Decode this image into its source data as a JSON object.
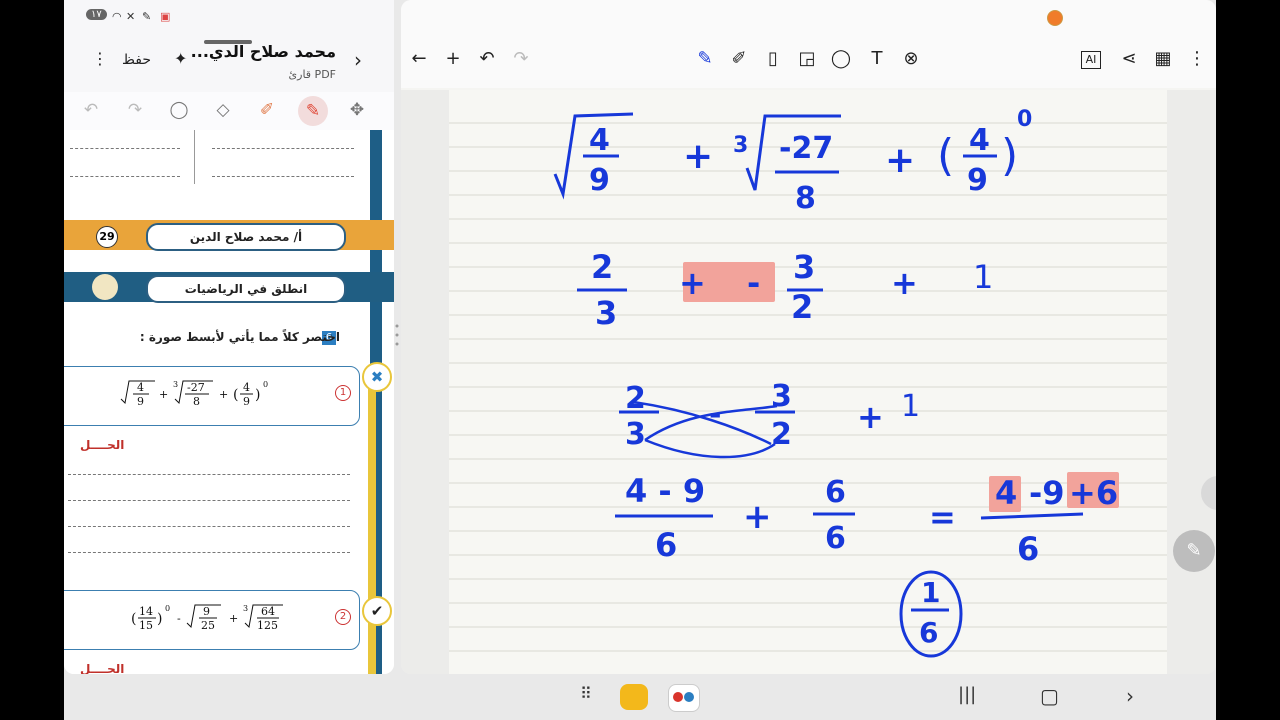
{
  "status_bar": {
    "badge": "۱۷",
    "icons": [
      "alarm-icon",
      "wifi-icon",
      "mute-icon",
      "pen-icon",
      "cast-icon"
    ]
  },
  "pdf_header": {
    "title": "محمد صلاح الدي...",
    "subtitle": "قارئ PDF",
    "save_label": "حفظ"
  },
  "pdf_tools": [
    "undo-icon",
    "redo-icon",
    "lasso-icon",
    "eraser-icon",
    "highlighter-icon",
    "pen-icon",
    "move-icon"
  ],
  "worksheet": {
    "page_number": "29",
    "author_label": "أ/ محمد صلاح الدين",
    "section_label": "انطلق في الرياضيات",
    "question_number": "6",
    "question_heading": "اختصر كلاً مما يأتي لأبسط صورة :",
    "item1_index": "1",
    "item2_index": "2",
    "solution_label": "الحــــل"
  },
  "math_item1": {
    "sqrt_num": "4",
    "sqrt_den": "9",
    "cbrt_index": "3",
    "cbrt_num": "-27",
    "cbrt_den": "8",
    "pow_num": "4",
    "pow_den": "9",
    "pow_exp": "0"
  },
  "math_item2": {
    "frac_num": "14",
    "frac_den": "15",
    "pow_exp": "0",
    "sqrt_num": "9",
    "sqrt_den": "25",
    "cbrt_index": "3",
    "cbrt_num": "64",
    "cbrt_den": "125"
  },
  "notes_toolbar": {
    "left_icons": [
      "back-arrow-icon",
      "add-icon",
      "undo-icon",
      "redo-icon"
    ],
    "center_icons": [
      "pen-icon",
      "highlighter-icon",
      "eraser-icon",
      "shape-icon",
      "lasso-icon",
      "text-icon",
      "close-pen-icon"
    ],
    "right_icons": [
      "ai-icon",
      "share-icon",
      "grid-icon",
      "more-icon"
    ],
    "ai_label": "AI"
  },
  "handwriting": {
    "line1": {
      "sqrt_num": "4",
      "sqrt_den": "9",
      "plus1": "+",
      "cbrt_index": "3",
      "cbrt_num": "-27",
      "cbrt_den": "8",
      "plus2": "+",
      "pow_num": "4",
      "pow_den": "9",
      "pow_exp": "0"
    },
    "line2": {
      "a_num": "2",
      "a_den": "3",
      "op1": "+",
      "op2": "-",
      "b_num": "3",
      "b_den": "2",
      "plus": "+",
      "c": "1"
    },
    "line3": {
      "a_num": "2",
      "a_den": "3",
      "minus": "-",
      "b_num": "3",
      "b_den": "2",
      "plus": "+",
      "c": "1"
    },
    "line4": {
      "left_num": "4 - 9",
      "left_den": "6",
      "plus": "+",
      "mid_num": "6",
      "mid_den": "6",
      "eq": "=",
      "right_num_a": "4",
      "right_num_b": "-9",
      "right_num_c": "+6",
      "right_den": "6"
    },
    "answer": {
      "num": "1",
      "den": "6"
    }
  },
  "colors": {
    "ink_blue": "#1738d9",
    "highlight_red": "#f2a39b",
    "band_blue": "#1e5e86",
    "band_orange": "#e9a43a",
    "band_yellow": "#e9c63b"
  },
  "nav_bar": [
    "apps-grid-icon",
    "files-app-icon",
    "screen-recorder-icon",
    "recents-icon",
    "home-icon",
    "back-icon"
  ]
}
